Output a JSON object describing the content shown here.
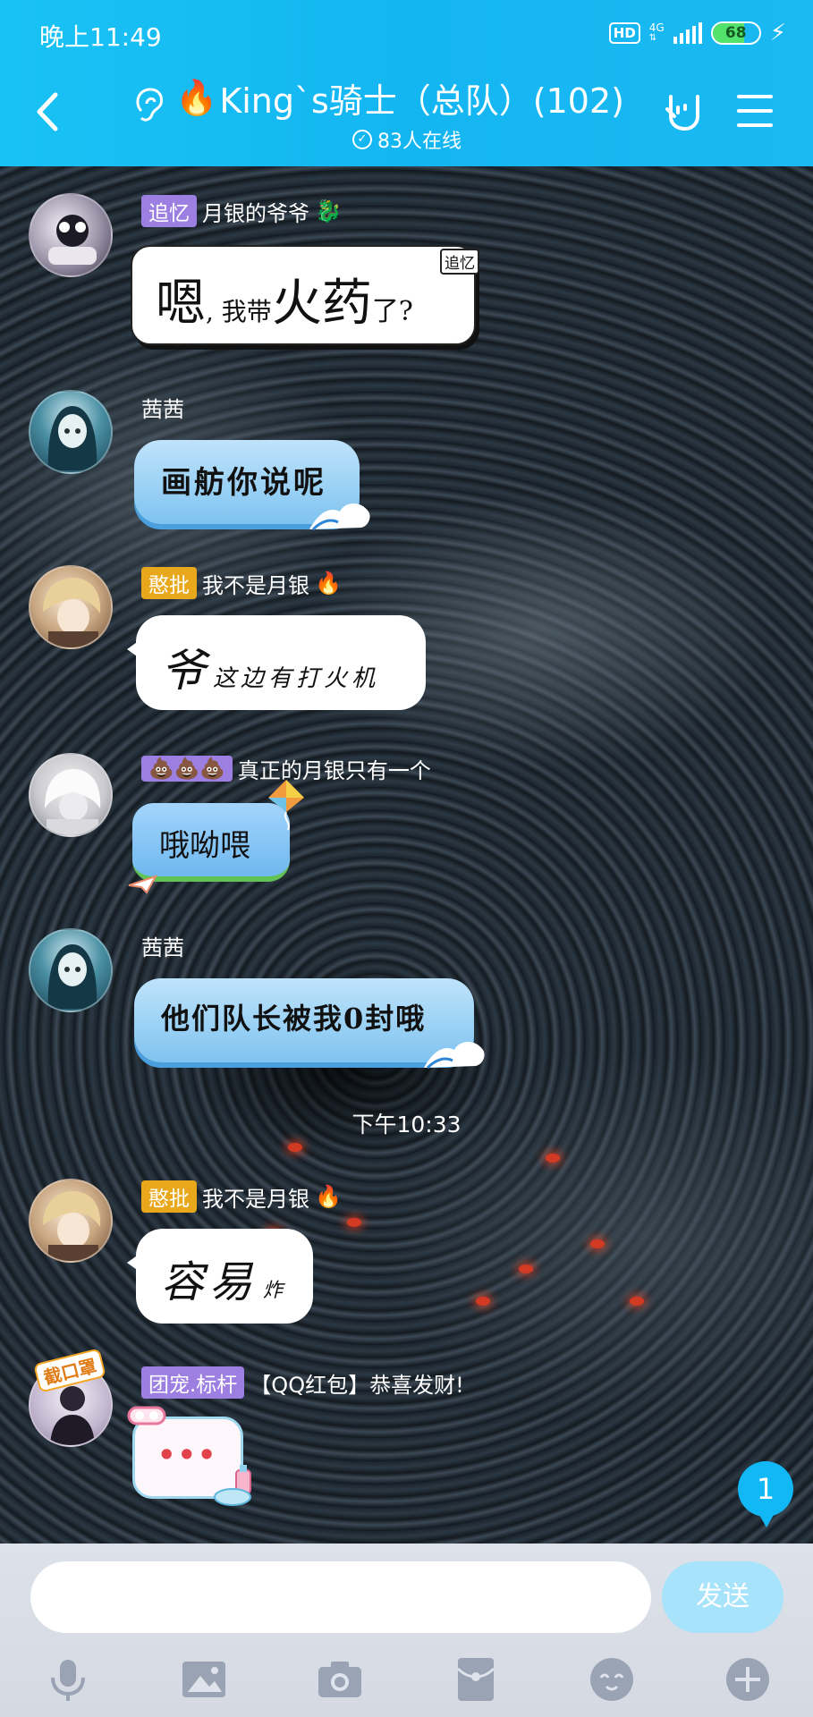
{
  "status_bar": {
    "time": "晚上11:49",
    "hd": "HD",
    "network": "4G",
    "battery": "68",
    "battery_level": 0.68
  },
  "header": {
    "title_emoji": "🔥",
    "title": "King`s骑士（总队）(102)",
    "online": "83人在线",
    "accent": "#14b6f2"
  },
  "messages": [
    {
      "sender_tag": "追忆",
      "sender": "月银的爷爷",
      "sender_emoji": "🐉",
      "text_a": "嗯",
      "text_b": ", 我带",
      "text_c": "火药",
      "text_d": "了?",
      "corner_label": "追忆"
    },
    {
      "sender": "茜茜",
      "text": "画舫你说呢"
    },
    {
      "sender_tag": "憨批",
      "sender": "我不是月银",
      "sender_emoji": "🔥",
      "text_big": "爷",
      "text": "这边有打火机"
    },
    {
      "sender_tag": "💩💩💩",
      "sender": "真正的月银只有一个",
      "text": "哦呦喂"
    },
    {
      "sender": "茜茜",
      "text": "他们队长被我0封哦"
    },
    {
      "sender_tag": "憨批",
      "sender": "我不是月银",
      "sender_emoji": "🔥",
      "text_big": "容易",
      "text": "炸"
    },
    {
      "sender_tag": "团宠.标杆",
      "sender": "【QQ红包】恭喜发财!",
      "avatar_label": "截口罩",
      "text": "•••"
    }
  ],
  "time_divider": "下午10:33",
  "unread_count": "1",
  "input": {
    "placeholder": "",
    "send_label": "发送"
  },
  "toolbar": [
    "mic-icon",
    "image-icon",
    "camera-icon",
    "red-packet-icon",
    "emoji-icon",
    "plus-icon"
  ]
}
